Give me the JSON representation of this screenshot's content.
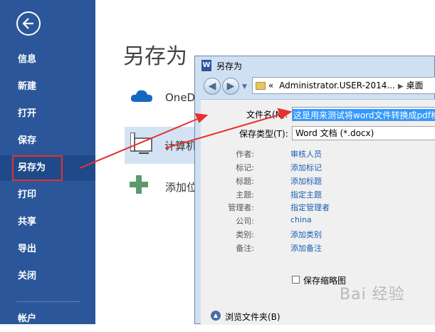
{
  "backstage": {
    "nav": [
      {
        "label": "信息"
      },
      {
        "label": "新建"
      },
      {
        "label": "打开"
      },
      {
        "label": "保存"
      },
      {
        "label": "另存为"
      },
      {
        "label": "打印"
      },
      {
        "label": "共享"
      },
      {
        "label": "导出"
      },
      {
        "label": "关闭"
      },
      {
        "label": "帐户"
      }
    ],
    "page_title": "另存为",
    "places": [
      {
        "label": "OneDr",
        "icon": "onedrive-cloud-icon"
      },
      {
        "label": "计算机",
        "icon": "computer-icon"
      },
      {
        "label": "添加位",
        "icon": "add-place-icon"
      }
    ]
  },
  "dialog": {
    "title": "另存为",
    "address": {
      "prefix": "«",
      "path": "Administrator.USER-2014...",
      "current": "桌面"
    },
    "filename_label": "文件名(N):",
    "filename_value": "这是用来测试将word文件转换成pdf格式",
    "filetype_label": "保存类型(T):",
    "filetype_value": "Word 文档 (*.docx)",
    "metadata": [
      {
        "label": "作者:",
        "value": "审核人员"
      },
      {
        "label": "标记:",
        "value": "添加标记"
      },
      {
        "label": "标题:",
        "value": "添加标题"
      },
      {
        "label": "主题:",
        "value": "指定主题"
      },
      {
        "label": "管理者:",
        "value": "指定管理者"
      },
      {
        "label": "公司:",
        "value": "china"
      },
      {
        "label": "类别:",
        "value": "添加类别"
      },
      {
        "label": "备注:",
        "value": "添加备注"
      }
    ],
    "thumbnail_label": "保存缩略图",
    "browse_label": "浏览文件夹(B)"
  },
  "watermark": "Bai 经验",
  "colors": {
    "ribbon_blue": "#2b579a",
    "highlight_red": "#e8302e",
    "selection_blue": "#3399ff"
  }
}
